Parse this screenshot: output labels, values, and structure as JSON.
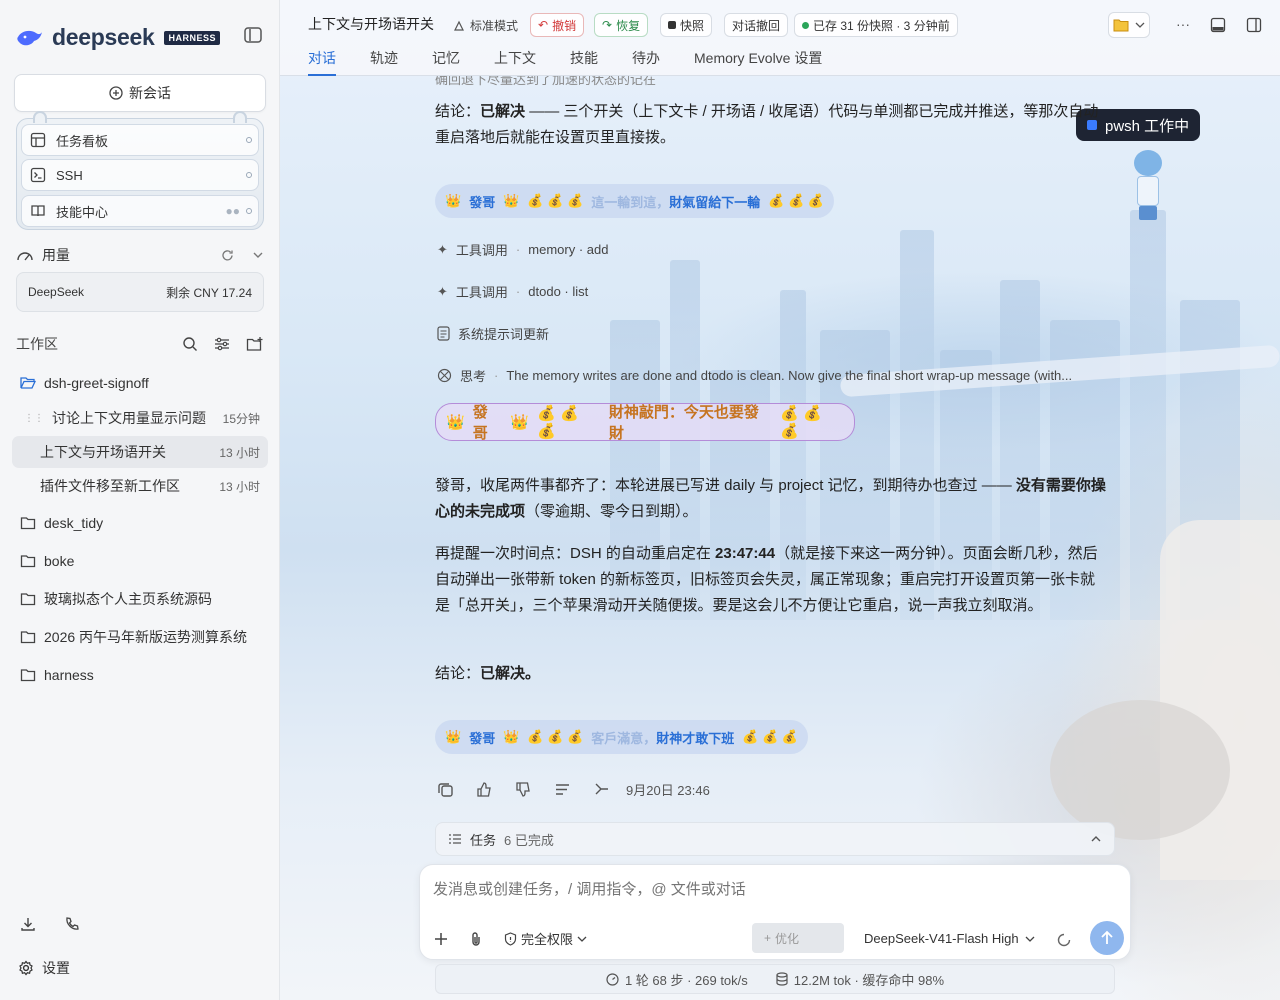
{
  "app": {
    "brand": "deepseek",
    "badge": "HARNESS"
  },
  "sidebar": {
    "new_chat": "新会话",
    "cards": [
      {
        "label": "任务看板",
        "icon": "kanban-icon"
      },
      {
        "label": "SSH",
        "icon": "terminal-icon"
      },
      {
        "label": "技能中心",
        "icon": "book-icon"
      }
    ],
    "usage_label": "用量",
    "provider": {
      "name": "DeepSeek",
      "balance": "剩余 CNY 17.24"
    },
    "workspace_label": "工作区",
    "tree": [
      {
        "label": "dsh-greet-signoff",
        "type": "folder-open"
      },
      {
        "label": "讨论上下文用量显示问题",
        "time": "15分钟",
        "type": "chat"
      },
      {
        "label": "上下文与开场语开关",
        "time": "13 小时",
        "type": "chat-selected"
      },
      {
        "label": "插件文件移至新工作区",
        "time": "13 小时",
        "type": "chat"
      },
      {
        "label": "desk_tidy",
        "type": "folder"
      },
      {
        "label": "boke",
        "type": "folder"
      },
      {
        "label": "玻璃拟态个人主页系统源码",
        "type": "folder"
      },
      {
        "label": "2026 丙午马年新版运势测算系统",
        "type": "folder"
      },
      {
        "label": "harness",
        "type": "folder"
      }
    ],
    "settings": "设置"
  },
  "header": {
    "title": "上下文与开场语开关",
    "mode": "标准模式",
    "undo": "撤销",
    "redo": "恢复",
    "snapshot": "快照",
    "rollback": "对话撤回",
    "saved": "已存 31 份快照 · 3 分钟前",
    "tabs": [
      "对话",
      "轨迹",
      "记忆",
      "上下文",
      "技能",
      "待办",
      "Memory Evolve 设置"
    ]
  },
  "float_status": "pwsh 工作中",
  "chat": {
    "top_partial": "确回退下尽量达到了加速的状态的记在",
    "conclusion1_prefix": "结论：",
    "conclusion1_bold": "已解决",
    "conclusion1_rest": " —— 三个开关（上下文卡 / 开场语 / 收尾语）代码与单测都已完成并推送，等那次自动重启落地后就能在设置页里直接拨。",
    "banner1": {
      "name": "發哥",
      "fade": "這一輪到這，",
      "text": "財氣留給下一輪"
    },
    "tool1": {
      "label": "工具调用",
      "detail": "memory · add"
    },
    "tool2": {
      "label": "工具调用",
      "detail": "dtodo · list"
    },
    "sys_update": "系统提示词更新",
    "think": {
      "label": "思考",
      "detail": "The memory writes are done and dtodo is clean. Now give the final short wrap-up message (with..."
    },
    "banner2": {
      "name": "發哥",
      "text": "財神敲門：今天也要發財"
    },
    "p1_normal": "發哥，收尾两件事都齐了：本轮进展已写进 daily 与 project 记忆，到期待办也查过 —— ",
    "p1_bold": "没有需要你操心的未完成项",
    "p1_tail": "（零逾期、零今日到期）。",
    "p2_a": "再提醒一次时间点：DSH 的自动重启定在 ",
    "p2_time": "23:47:44",
    "p2_b": "（就是接下来这一两分钟）。页面会断几秒，然后自动弹出一张带新 token 的新标签页，旧标签页会失灵，属正常现象；重启完打开设置页第一张卡就是「总开关」，三个苹果滑动开关随便拨。要是这会儿不方便让它重启，说一声我立刻取消。",
    "conclusion2_prefix": "结论：",
    "conclusion2_bold": "已解决。",
    "banner3": {
      "name": "發哥",
      "fade": "客戶滿意，",
      "text": "財神才敢下班"
    },
    "timestamp": "9月20日 23:46"
  },
  "tasks": {
    "label": "任务",
    "count": "6 已完成"
  },
  "composer": {
    "placeholder": "发消息或创建任务，/ 调用指令，@ 文件或对话",
    "permission": "完全权限",
    "optimize": "优化",
    "model": "DeepSeek-V41-Flash High"
  },
  "statusbar": {
    "steps": "1 轮 68 步 · 269 tok/s",
    "tokens": "12.2M tok · 缓存命中 98%"
  },
  "colors": {
    "accent": "#2a6fd6",
    "gold": "#c67420"
  }
}
